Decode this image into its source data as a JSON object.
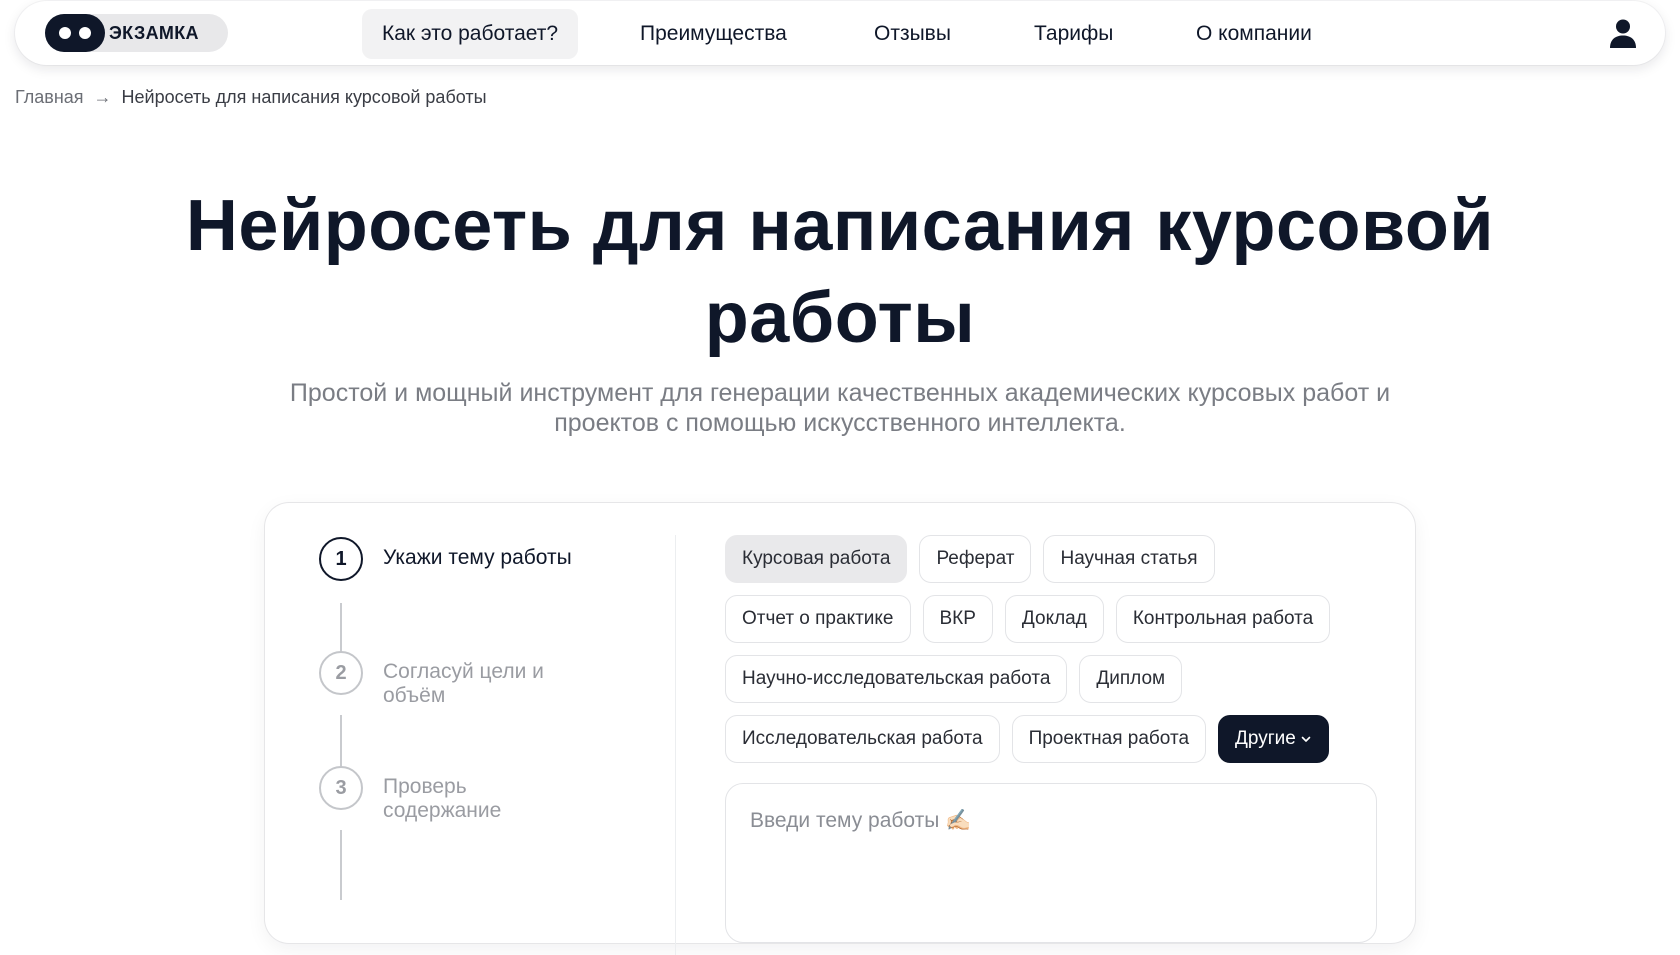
{
  "brand": {
    "name": "ЭКЗАМКА"
  },
  "nav": {
    "items": [
      {
        "label": "Как это работает?"
      },
      {
        "label": "Преимущества"
      },
      {
        "label": "Отзывы"
      },
      {
        "label": "Тарифы"
      },
      {
        "label": "О компании"
      }
    ],
    "account_icon": "user-icon"
  },
  "breadcrumb": {
    "home": "Главная",
    "separator": "→",
    "current": "Нейросеть для написания курсовой работы"
  },
  "hero": {
    "title": "Нейросеть для написания курсовой работы",
    "subtitle": "Простой и мощный инструмент для генерации качественных академических курсовых работ и проектов с помощью искусственного интеллекта."
  },
  "steps": [
    {
      "number": "1",
      "label": "Укажи тему работы"
    },
    {
      "number": "2",
      "label": "Согласуй цели и объём"
    },
    {
      "number": "3",
      "label": "Проверь содержание"
    }
  ],
  "work_types": {
    "rows": [
      [
        "Курсовая работа",
        "Реферат",
        "Научная статья"
      ],
      [
        "Отчет о практике",
        "ВКР",
        "Доклад",
        "Контрольная работа"
      ],
      [
        "Научно-исследовательская работа",
        "Диплом"
      ],
      [
        "Исследовательская работа",
        "Проектная работа"
      ]
    ],
    "selected": "Курсовая работа",
    "more_label": "Другие"
  },
  "topic": {
    "placeholder": "Введи тему работы ✍🏻",
    "value": ""
  },
  "colors": {
    "primary": "#0f1729",
    "muted": "#7a7d84",
    "chip_selected": "#e9e9eb"
  }
}
